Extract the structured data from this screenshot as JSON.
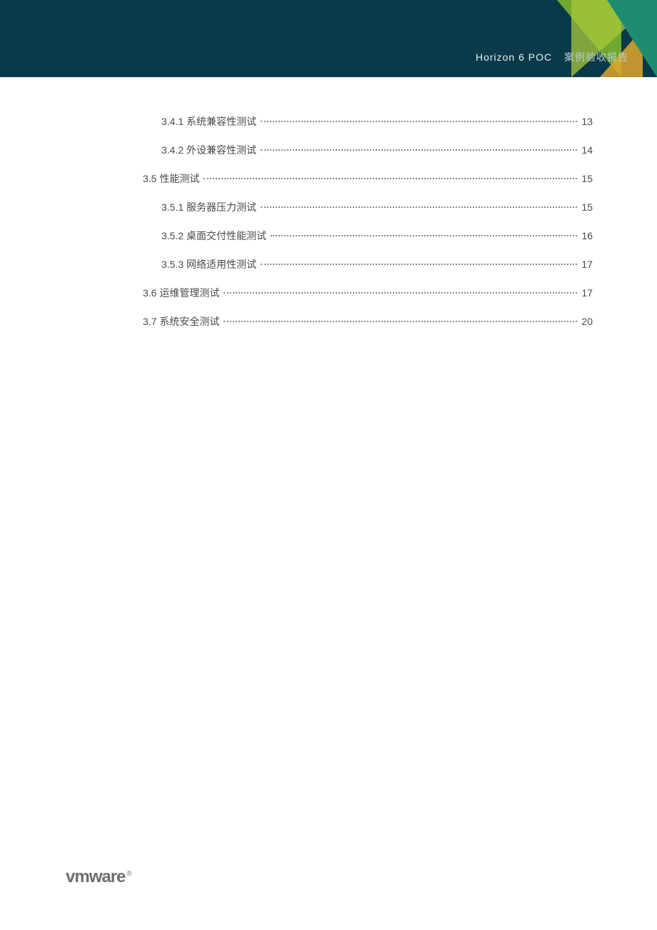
{
  "header": {
    "title_main": "Horizon 6 POC",
    "title_sub": "案例验收报告"
  },
  "toc": [
    {
      "level": 2,
      "label": "3.4.1 系统兼容性测试",
      "page": "13"
    },
    {
      "level": 2,
      "label": "3.4.2 外设兼容性测试",
      "page": "14"
    },
    {
      "level": 1,
      "label": "3.5 性能测试",
      "page": "15"
    },
    {
      "level": 2,
      "label": "3.5.1 服务器压力测试",
      "page": "15"
    },
    {
      "level": 2,
      "label": "3.5.2 桌面交付性能测试",
      "page": "16"
    },
    {
      "level": 2,
      "label": "3.5.3 网络适用性测试",
      "page": "17"
    },
    {
      "level": 1,
      "label": "3.6 运维管理测试",
      "page": "17"
    },
    {
      "level": 1,
      "label": "3.7 系统安全测试",
      "page": "20"
    }
  ],
  "footer": {
    "logo_text": "vmware",
    "reg_mark": "®"
  }
}
